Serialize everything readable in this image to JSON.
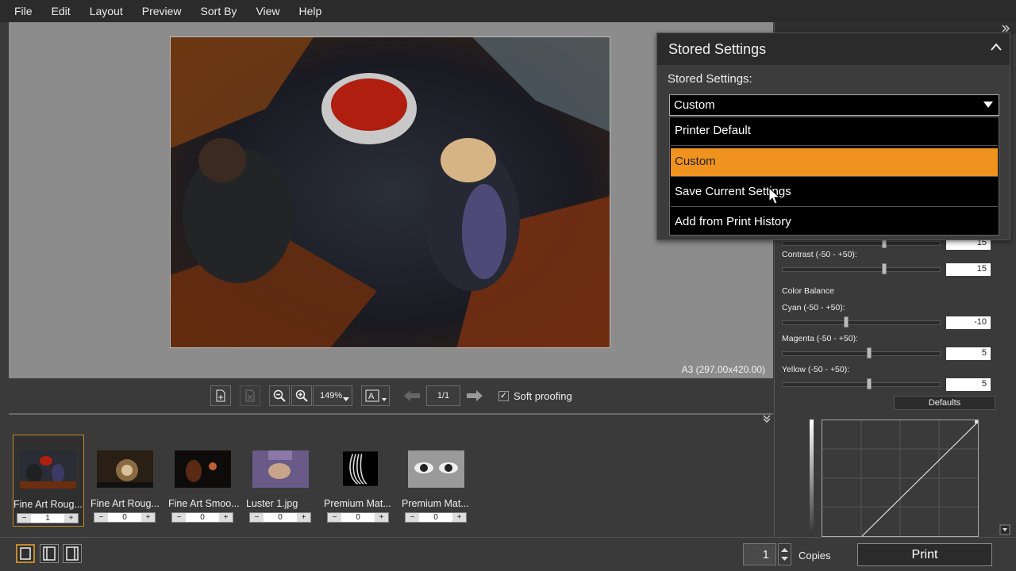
{
  "menu": [
    "File",
    "Edit",
    "Layout",
    "Preview",
    "Sort By",
    "View",
    "Help"
  ],
  "preview": {
    "paper_size": "A3 (297.00x420.00)"
  },
  "toolbar": {
    "zoom": "149%",
    "page": "1/1",
    "soft_proofing_label": "Soft proofing",
    "soft_proofing_checked": true
  },
  "thumbnails": [
    {
      "label": "Fine Art Roug...",
      "count": "1",
      "selected": true
    },
    {
      "label": "Fine Art Roug...",
      "count": "0",
      "selected": false
    },
    {
      "label": "Fine Art Smoo...",
      "count": "0",
      "selected": false
    },
    {
      "label": "Luster 1.jpg",
      "count": "0",
      "selected": false
    },
    {
      "label": "Premium Mat...",
      "count": "0",
      "selected": false
    },
    {
      "label": "Premium Mat...",
      "count": "0",
      "selected": false
    }
  ],
  "footer": {
    "copies_value": "1",
    "copies_label": "Copies",
    "print_label": "Print"
  },
  "adjustments": {
    "partial_value": "15",
    "contrast": {
      "label": "Contrast (-50 - +50):",
      "value": "15",
      "level": 15
    },
    "color_balance_label": "Color Balance",
    "cyan": {
      "label": "Cyan (-50 - +50):",
      "value": "-10",
      "level": -10
    },
    "magenta": {
      "label": "Magenta (-50 - +50):",
      "value": "5",
      "level": 5
    },
    "yellow": {
      "label": "Yellow (-50 - +50):",
      "value": "5",
      "level": 5
    },
    "defaults_label": "Defaults"
  },
  "stored_settings": {
    "title": "Stored Settings",
    "field_label": "Stored Settings:",
    "selected_value": "Custom",
    "options": [
      "Printer Default",
      "Custom",
      "Save Current Settings",
      "Add from Print History"
    ],
    "highlighted_index": 1
  },
  "colors": {
    "accent": "#f0921e",
    "selection_border": "#c08a2c"
  }
}
